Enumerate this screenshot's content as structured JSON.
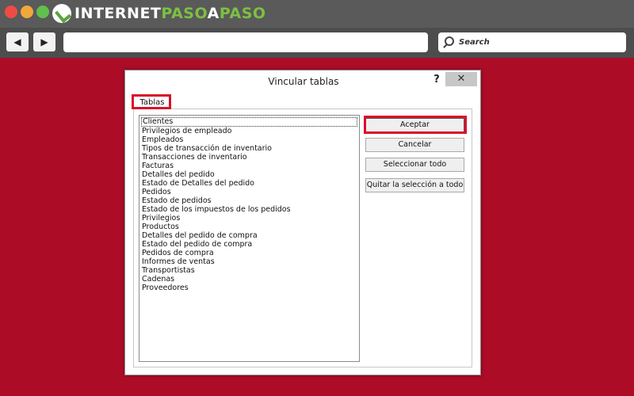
{
  "browser": {
    "logo": {
      "part1": "INTERNET",
      "part2": "PASO",
      "part3": "A",
      "part4": "PASO"
    },
    "nav": {
      "back_label": "◀",
      "forward_label": "▶"
    },
    "search_placeholder": "Search"
  },
  "dialog": {
    "title": "Vincular tablas",
    "help_label": "?",
    "close_label": "✕",
    "tab_label": "Tablas",
    "tables": [
      "Clientes",
      "Privilegios de empleado",
      "Empleados",
      "Tipos de transacción de inventario",
      "Transacciones de inventario",
      "Facturas",
      "Detalles del pedido",
      "Estado de Detalles del pedido",
      "Pedidos",
      "Estado de pedidos",
      "Estado de los impuestos de los pedidos",
      "Privilegios",
      "Productos",
      "Detalles del pedido de compra",
      "Estado del pedido de compra",
      "Pedidos de compra",
      "Informes de ventas",
      "Transportistas",
      "Cadenas",
      "Proveedores"
    ],
    "buttons": {
      "ok": "Aceptar",
      "cancel": "Cancelar",
      "select_all": "Seleccionar todo",
      "clear_selection": "Quitar la selección a todo"
    }
  },
  "colors": {
    "background": "#ad0c26",
    "highlight": "#d8102b",
    "logo_green": "#7cc043"
  }
}
